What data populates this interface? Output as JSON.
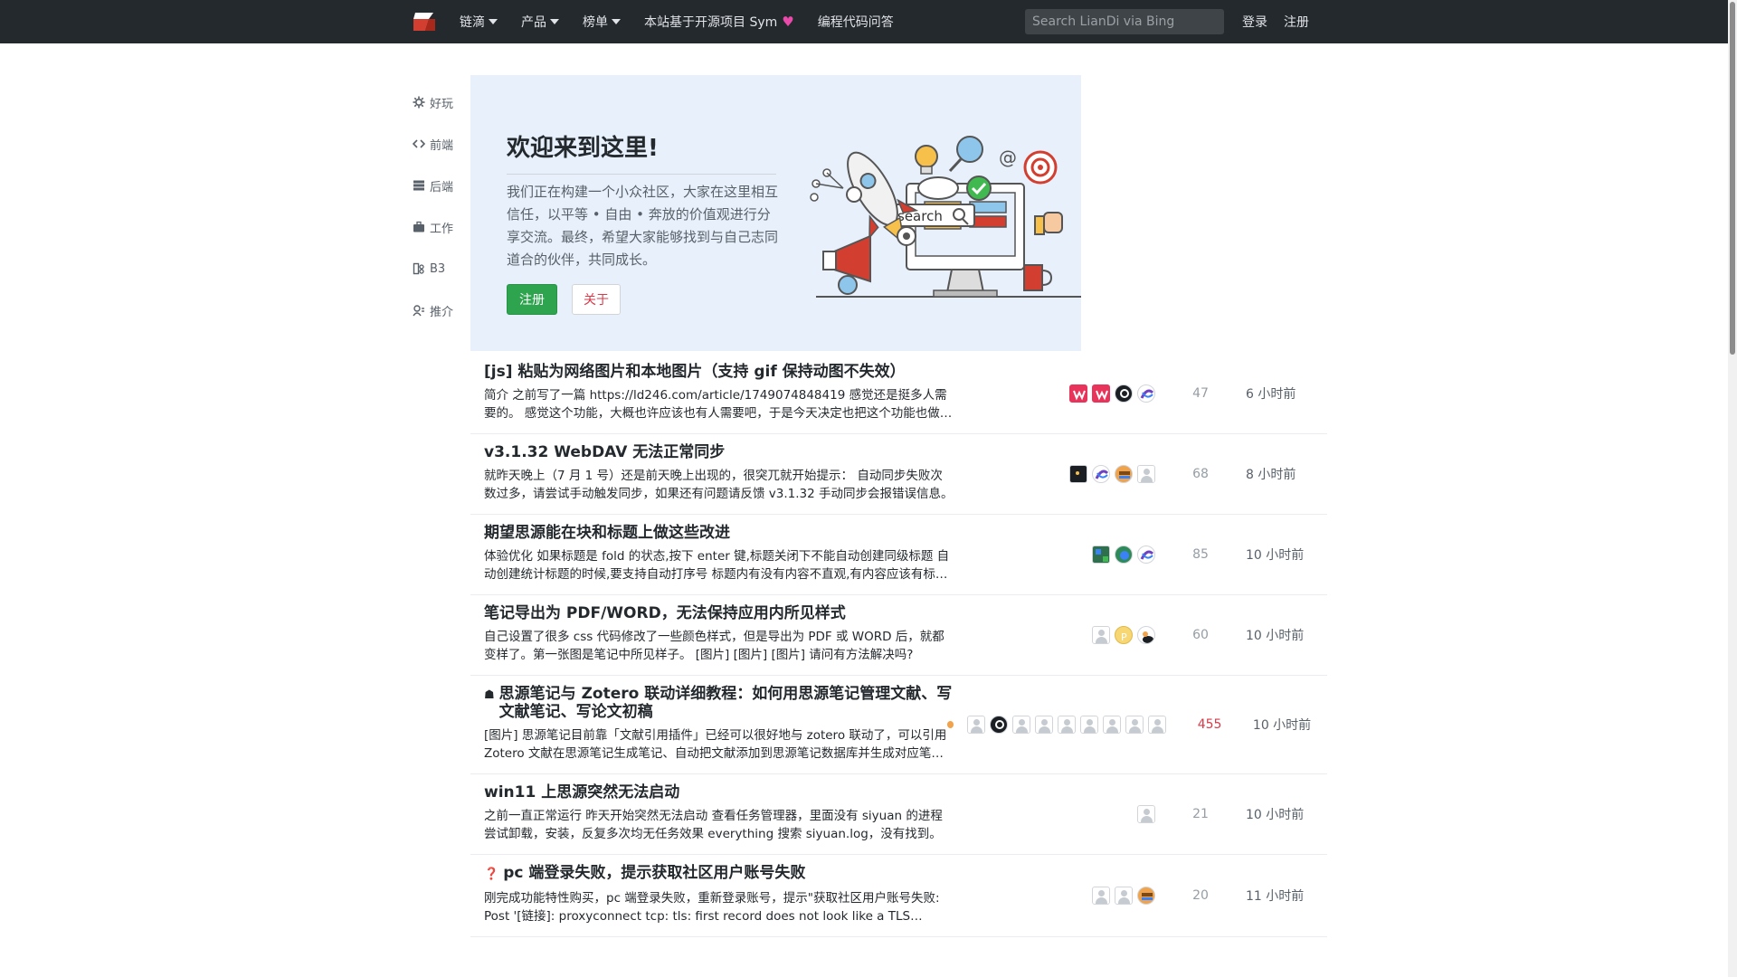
{
  "nav": {
    "items": [
      {
        "label": "链滴",
        "has_caret": true
      },
      {
        "label": "产品",
        "has_caret": true
      },
      {
        "label": "榜单",
        "has_caret": true
      },
      {
        "label": "本站基于开源项目 Sym",
        "has_caret": false,
        "heart": "♥"
      },
      {
        "label": "编程代码问答",
        "has_caret": false
      }
    ],
    "search_placeholder": "Search LianDi via Bing",
    "login": "登录",
    "register": "注册"
  },
  "sidebar": {
    "items": [
      {
        "label": "好玩",
        "icon": "gear-icon"
      },
      {
        "label": "前端",
        "icon": "code-icon"
      },
      {
        "label": "后端",
        "icon": "server-icon"
      },
      {
        "label": "工作",
        "icon": "briefcase-icon"
      },
      {
        "label": "B3",
        "icon": "b3-icon"
      },
      {
        "label": "推介",
        "icon": "recommend-icon"
      }
    ]
  },
  "hero": {
    "title": "欢迎来到这里!",
    "description": "我们正在构建一个小众社区，大家在这里相互信任，以平等 • 自由 • 奔放的价值观进行分享交流。最终，希望大家能够找到与自己志同道合的伙伴，共同成长。",
    "register_button": "注册",
    "about_button": "关于",
    "illustration_search_text": "search"
  },
  "colors": {
    "topbar": "#24292e",
    "hero_bg": "#e7f0fb",
    "register_green": "#2ea44f",
    "about_red": "#d73a49",
    "hot_count": "#d73a49"
  },
  "articles": [
    {
      "title": "[js] 粘贴为网络图片和本地图片（支持 gif 保持动图不失效）",
      "desc": "简介 之前写了一篇 https://ld246.com/article/1749074848419 感觉还是挺多人需要的。 感觉这个功能，大概也许应该也有人需要吧，于是今天决定也把这个功能也做出来了。",
      "title_icon": "",
      "avatars": [
        "w-red",
        "w-red",
        "dark-round",
        "purple-swirl"
      ],
      "hot_dot": false,
      "count": "47",
      "count_hot": false,
      "time": "6 小时前"
    },
    {
      "title": "v3.1.32 WebDAV 无法正常同步",
      "desc": "就昨天晚上（7 月 1 号）还是前天晚上出现的，很突兀就开始提示： 自动同步失败次数过多，请尝试手动触发同步，如果还有问题请反馈 v3.1.32 手动同步会报错误信息。",
      "title_icon": "",
      "avatars": [
        "black-sq",
        "purple-swirl",
        "orange-round",
        "ghost"
      ],
      "hot_dot": false,
      "count": "68",
      "count_hot": false,
      "time": "8 小时前"
    },
    {
      "title": "期望思源能在块和标题上做这些改进",
      "desc": "体验优化 如果标题是 fold 的状态,按下 enter 键,标题关闭下不能自动创建同级标题 自动创建统计标题的时候,要支持自动打序号 标题内有没有内容不直观,有内容应该有标记。",
      "title_icon": "",
      "avatars": [
        "green-sq",
        "green-round",
        "purple-swirl"
      ],
      "hot_dot": false,
      "count": "85",
      "count_hot": false,
      "time": "10 小时前"
    },
    {
      "title": "笔记导出为 PDF/WORD，无法保持应用内所见样式",
      "desc": "自己设置了很多 css 代码修改了一些颜色样式，但是导出为 PDF 或 WORD 后，就都变样了。第一张图是笔记中所见样子。 [图片] [图片] [图片] 请问有方法解决吗?",
      "title_icon": "",
      "avatars": [
        "ghost",
        "yellow-p",
        "cat"
      ],
      "hot_dot": false,
      "count": "60",
      "count_hot": false,
      "time": "10 小时前"
    },
    {
      "title": "思源笔记与 Zotero 联动详细教程：如何用思源笔记管理文献、写文献笔记、写论文初稿",
      "desc": "[图片] 思源笔记目前靠「文献引用插件」已经可以很好地与 zotero 联动了，可以引用 Zotero 文献在思源笔记生成笔记、自动把文献添加到思源笔记数据库并生成对应笔记。",
      "title_icon": "☗",
      "avatars": [
        "ghost",
        "dark-round",
        "ghost",
        "ghost",
        "ghost",
        "ghost",
        "ghost",
        "ghost",
        "ghost"
      ],
      "hot_dot": true,
      "count": "455",
      "count_hot": true,
      "time": "10 小时前"
    },
    {
      "title": "win11 上思源突然无法启动",
      "desc": "之前一直正常运行 昨天开始突然无法启动 查看任务管理器，里面没有 siyuan 的进程 尝试卸载，安装，反复多次均无任务效果 everything 搜索 siyuan.log，没有找到。",
      "title_icon": "",
      "avatars": [
        "ghost"
      ],
      "hot_dot": false,
      "count": "21",
      "count_hot": false,
      "time": "10 小时前"
    },
    {
      "title": "pc 端登录失败，提示获取社区用户账号失败",
      "desc": "刚完成功能特性购买，pc 端登录失败，重新登录账号，提示\"获取社区用户账号失败: Post '[链接]: proxyconnect tcp: tls: first record does not look like a TLS handshake'",
      "title_icon": "❓",
      "avatars": [
        "ghost",
        "ghost",
        "orange-round"
      ],
      "hot_dot": false,
      "count": "20",
      "count_hot": false,
      "time": "11 小时前"
    }
  ]
}
